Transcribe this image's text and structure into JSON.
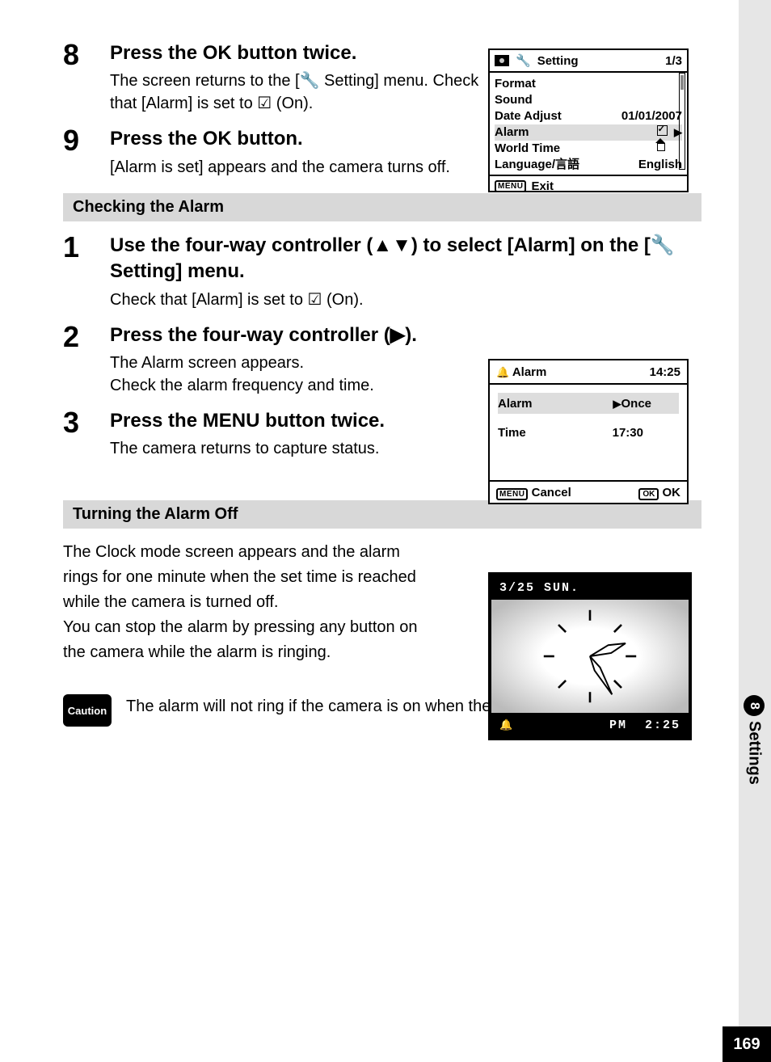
{
  "sideTab": {
    "chapterNum": "8",
    "chapterLabel": "Settings"
  },
  "pageNumber": "169",
  "steps_top": [
    {
      "num": "8",
      "title_parts": [
        "Press the ",
        "OK",
        " button twice."
      ],
      "desc_parts": [
        "The screen returns to the [",
        "🔧",
        " Setting] menu. Check that [Alarm] is set to ",
        "☑",
        " (On)."
      ]
    },
    {
      "num": "9",
      "title_parts": [
        "Press the ",
        "OK",
        " button."
      ],
      "desc_parts": [
        "[Alarm is set] appears and the camera turns off."
      ]
    }
  ],
  "heading_check": "Checking the Alarm",
  "steps_check": [
    {
      "num": "1",
      "title": "Use the four-way controller (▲▼) to select [Alarm] on the [🔧Setting] menu.",
      "desc": "Check that [Alarm] is set to ☑ (On)."
    },
    {
      "num": "2",
      "title": "Press the four-way controller (▶).",
      "desc": "The Alarm screen appears.\nCheck the alarm frequency and time."
    },
    {
      "num": "3",
      "title_parts": [
        "Press the ",
        "MENU",
        " button twice."
      ],
      "desc": "The camera returns to capture status."
    }
  ],
  "heading_off": "Turning the Alarm Off",
  "para_off": "The Clock mode screen appears and the alarm rings for one minute when the set time is reached while the camera is turned off.\nYou can stop the alarm by pressing any button on the camera while the alarm is ringing.",
  "caution_label": "Caution",
  "caution_text": "The alarm will not ring if the camera is on when the set time is reached.",
  "lcd_setting": {
    "title": "Setting",
    "page": "1/3",
    "rows": [
      {
        "label": "Format",
        "value": ""
      },
      {
        "label": "Sound",
        "value": ""
      },
      {
        "label": "Date Adjust",
        "value": "01/01/2007"
      },
      {
        "label": "Alarm",
        "value": "checkbox",
        "highlight": true,
        "arrow": true
      },
      {
        "label": "World Time",
        "value": "home"
      },
      {
        "label": "Language/言語",
        "value": "English"
      }
    ],
    "exit_tag": "MENU",
    "exit": "Exit"
  },
  "lcd_alarm": {
    "title_icon": "bell",
    "title": "Alarm",
    "clock": "14:25",
    "rows": [
      {
        "label": "Alarm",
        "value": "Once",
        "arrow": true,
        "highlight": true
      },
      {
        "label": "Time",
        "value": "17:30"
      }
    ],
    "footer_left_tag": "MENU",
    "footer_left": "Cancel",
    "footer_right_tag": "OK",
    "footer_right": "OK"
  },
  "lcd_clock": {
    "date": "3/25",
    "weekday": "SUN.",
    "ampm": "PM",
    "time": "2:25"
  }
}
